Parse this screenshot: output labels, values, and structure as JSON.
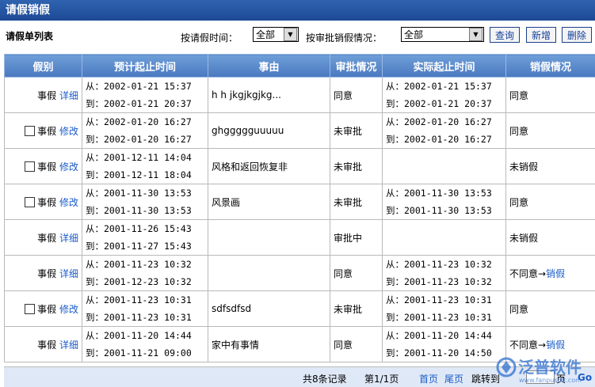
{
  "title": "请假销假",
  "toolbar": {
    "list_title": "请假单列表",
    "filter_time_label": "按请假时间：",
    "filter_time_value": "全部",
    "filter_status_label": "按审批销假情况：",
    "filter_status_value": "全部",
    "btn_query": "查询",
    "btn_add": "新增",
    "btn_delete": "删除"
  },
  "table": {
    "headers": [
      "假别",
      "预计起止时间",
      "事由",
      "审批情况",
      "实际起止时间",
      "销假情况"
    ],
    "rows": [
      {
        "checkbox": false,
        "type": "事假",
        "action": "详细",
        "plan_from": "从：2002-01-21 15:37",
        "plan_to": "到：2002-01-21 20:37",
        "reason": "h h jkgjkgjkg...",
        "approval": "同意",
        "act_from": "从：2002-01-21 15:37",
        "act_to": "到：2002-01-21 20:37",
        "leave_status": "同意",
        "leave_link": ""
      },
      {
        "checkbox": true,
        "type": "事假",
        "action": "修改",
        "plan_from": "从：2002-01-20 16:27",
        "plan_to": "到：2002-01-20 16:27",
        "reason": "ghggggguuuuu",
        "approval": "未审批",
        "act_from": "从：2002-01-20 16:27",
        "act_to": "到：2002-01-20 16:27",
        "leave_status": "同意",
        "leave_link": ""
      },
      {
        "checkbox": true,
        "type": "事假",
        "action": "修改",
        "plan_from": "从：2001-12-11 14:04",
        "plan_to": "到：2001-12-11 18:04",
        "reason": "风格和返回恢复非",
        "approval": "未审批",
        "act_from": "",
        "act_to": "",
        "leave_status": "未销假",
        "leave_link": ""
      },
      {
        "checkbox": true,
        "type": "事假",
        "action": "修改",
        "plan_from": "从：2001-11-30 13:53",
        "plan_to": "到：2001-11-30 13:53",
        "reason": "风景画",
        "approval": "未审批",
        "act_from": "从：2001-11-30 13:53",
        "act_to": "到：2001-11-30 13:53",
        "leave_status": "同意",
        "leave_link": ""
      },
      {
        "checkbox": false,
        "type": "事假",
        "action": "详细",
        "plan_from": "从：2001-11-26 15:43",
        "plan_to": "到：2001-11-27 15:43",
        "reason": "",
        "approval": "审批中",
        "act_from": "",
        "act_to": "",
        "leave_status": "未销假",
        "leave_link": ""
      },
      {
        "checkbox": false,
        "type": "事假",
        "action": "详细",
        "plan_from": "从：2001-11-23 10:32",
        "plan_to": "到：2001-12-23 10:32",
        "reason": "",
        "approval": "同意",
        "act_from": "从：2001-11-23 10:32",
        "act_to": "到：2001-11-23 10:32",
        "leave_status": "不同意→",
        "leave_link": "销假"
      },
      {
        "checkbox": true,
        "type": "事假",
        "action": "修改",
        "plan_from": "从：2001-11-23 10:31",
        "plan_to": "到：2001-11-23 10:31",
        "reason": "sdfsdfsd",
        "approval": "未审批",
        "act_from": "从：2001-11-23 10:31",
        "act_to": "到：2001-11-23 10:31",
        "leave_status": "同意",
        "leave_link": ""
      },
      {
        "checkbox": false,
        "type": "事假",
        "action": "详细",
        "plan_from": "从：2001-11-20 14:44",
        "plan_to": "到：2001-11-21 09:00",
        "reason": "家中有事情",
        "approval": "同意",
        "act_from": "从：2001-11-20 14:44",
        "act_to": "到：2001-11-20 14:50",
        "leave_status": "不同意→",
        "leave_link": "销假"
      }
    ]
  },
  "footer": {
    "count": "共8条记录",
    "page": "第1/1页",
    "first": "首页",
    "last": "尾页",
    "jump": "跳转到",
    "page_unit": "页",
    "go": "Go"
  },
  "watermark": {
    "text": "泛普软件",
    "url": "www.fanpusoft.com"
  }
}
